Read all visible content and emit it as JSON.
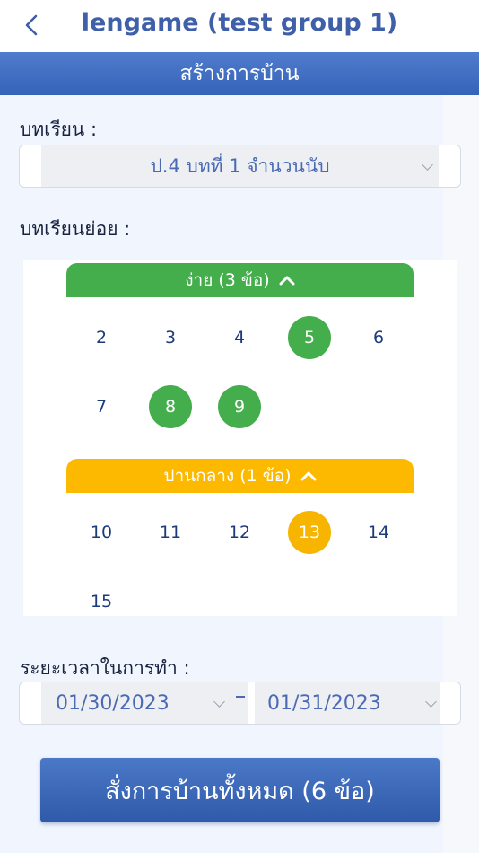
{
  "header": {
    "title": "lengame (test group 1)",
    "back_icon": "chevron-left-icon"
  },
  "subheader": {
    "title": "สร้างการบ้าน"
  },
  "lesson": {
    "label": "บทเรียน :",
    "selected": "ป.4 บทที่ 1 จำนวนนับ"
  },
  "sublesson": {
    "label": "บทเรียนย่อย :"
  },
  "levels": [
    {
      "title": "ง่าย (3 ข้อ)",
      "color": "#44ad4c",
      "items": [
        "2",
        "3",
        "4",
        "5",
        "6",
        "7",
        "8",
        "9"
      ],
      "selected": [
        "5",
        "8",
        "9"
      ]
    },
    {
      "title": "ปานกลาง (1 ข้อ)",
      "color": "#fdb900",
      "items": [
        "10",
        "11",
        "12",
        "13",
        "14",
        "15"
      ],
      "selected": [
        "13"
      ]
    }
  ],
  "duration": {
    "label": "ระยะเวลาในการทำ :",
    "start": "01/30/2023",
    "end": "01/31/2023"
  },
  "submit": {
    "label": "สั่งการบ้านทั้งหมด (6 ข้อ)"
  }
}
